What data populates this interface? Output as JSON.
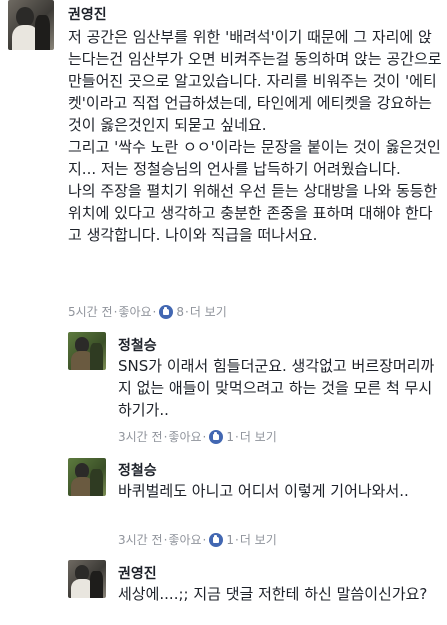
{
  "comment1": {
    "author": "권영진",
    "paragraphs": [
      "저 공간은 임산부를 위한 '배려석'이기 때문에 그 자리에 앉는다는건 임산부가 오면 비켜주는걸 동의하며 앉는 공간으로 만들어진 곳으로 알고있습니다. 자리를 비워주는 것이 '에티켓'이라고 직접 언급하셨는데, 타인에게 에티켓을 강요하는 것이 옳은것인지 되묻고 싶네요.",
      "그리고 '싹수 노란 ㅇㅇ'이라는 문장을 붙이는 것이 옳은것인지... 저는 정철승님의 언사를 납득하기 어려웠습니다.",
      "나의 주장을 펼치기 위해선 우선 듣는 상대방을 나와 동등한 위치에 있다고 생각하고 충분한 존중을 표하며 대해야 한다고 생각합니다. 나이와 직급을 떠나서요."
    ],
    "time": "5시간 전",
    "like": "좋아요",
    "like_count": "8",
    "more": "더 보기"
  },
  "reply1": {
    "author": "정철승",
    "text": "SNS가 이래서 힘들더군요. 생각없고 버르장머리까지 없는 애들이 맞먹으려고 하는 것을 모른 척 무시하기가..",
    "time": "3시간 전",
    "like": "좋아요",
    "like_count": "1",
    "more": "더 보기"
  },
  "reply2": {
    "author": "정철승",
    "text": "바퀴벌레도 아니고 어디서 이렇게 기어나와서..",
    "time": "3시간 전",
    "like": "좋아요",
    "like_count": "1",
    "more": "더 보기"
  },
  "reply3": {
    "author": "권영진",
    "text": "세상에....;; 지금 댓글 저한테 하신 말씀이신가요?"
  },
  "separator": "·",
  "colors": {
    "name": "#1d2129",
    "meta": "#90949c",
    "like_blue": "#4267b2"
  }
}
